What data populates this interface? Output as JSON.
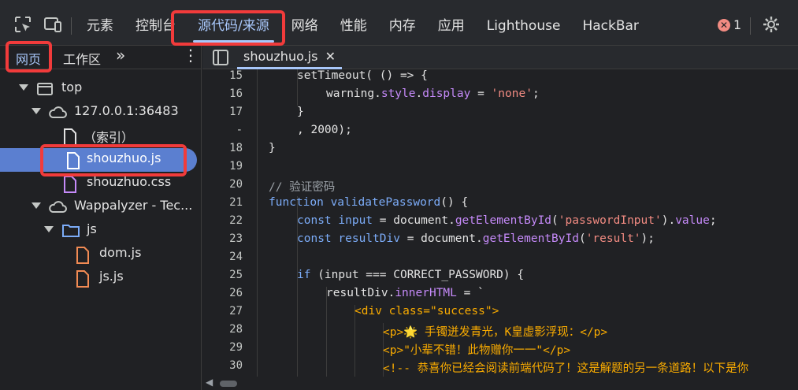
{
  "toolbar": {
    "tabs": [
      "元素",
      "控制台",
      "源代码/来源",
      "网络",
      "性能",
      "内存",
      "应用",
      "Lighthouse",
      "HackBar"
    ],
    "active_tab": "源代码/来源",
    "error_count": "1"
  },
  "sidebar": {
    "tabs": [
      "网页",
      "工作区"
    ],
    "more": "»",
    "tree": {
      "top": "top",
      "host": "127.0.0.1:36483",
      "index": "（索引）",
      "file1": "shouzhuo.js",
      "file2": "shouzhuo.css",
      "ext": "Wappalyzer - Tec...",
      "folder": "js",
      "dom": "dom.js",
      "js": "js.js"
    }
  },
  "editor": {
    "tab": "shouzhuo.js",
    "close": "✕",
    "line_numbers": [
      "15",
      "16",
      "17",
      "-",
      "18",
      "19",
      "20",
      "21",
      "22",
      "23",
      "24",
      "25",
      "26",
      "27",
      "28",
      "29",
      "30"
    ],
    "lines": {
      "l15": "setTimeout( () => {",
      "l16a": "warning.",
      "l16b": "style",
      "l16c": ".",
      "l16d": "display",
      "l16e": " = ",
      "l16f": "'none'",
      "l16g": ";",
      "l17": "}",
      "l17b": ", 2000);",
      "l18": "}",
      "l20": "// 验证密码",
      "l21a": "function ",
      "l21b": "validatePassword",
      "l21c": "() {",
      "l22a": "const ",
      "l22b": "input",
      "l22c": " = document.",
      "l22d": "getElementById",
      "l22e": "(",
      "l22f": "'passwordInput'",
      "l22g": ").",
      "l22h": "value",
      "l22i": ";",
      "l23a": "const ",
      "l23b": "resultDiv",
      "l23c": " = document.",
      "l23d": "getElementById",
      "l23e": "(",
      "l23f": "'result'",
      "l23g": ");",
      "l25a": "if ",
      "l25b": "(input === CORRECT_PASSWORD) {",
      "l26a": "resultDiv.",
      "l26b": "innerHTML",
      "l26c": " = `",
      "l27": "<div class=\"success\">",
      "l28a": "<p>",
      "l28b": "🌟 手镯迸发青光，K皇虚影浮现：",
      "l28c": "</p>",
      "l29a": "<p>",
      "l29b": "\"小辈不错！此物赠你一一\"",
      "l29c": "</p>",
      "l30": "<!-- 恭喜你已经会阅读前端代码了！这是解题的另一条道路！以下是你"
    }
  }
}
